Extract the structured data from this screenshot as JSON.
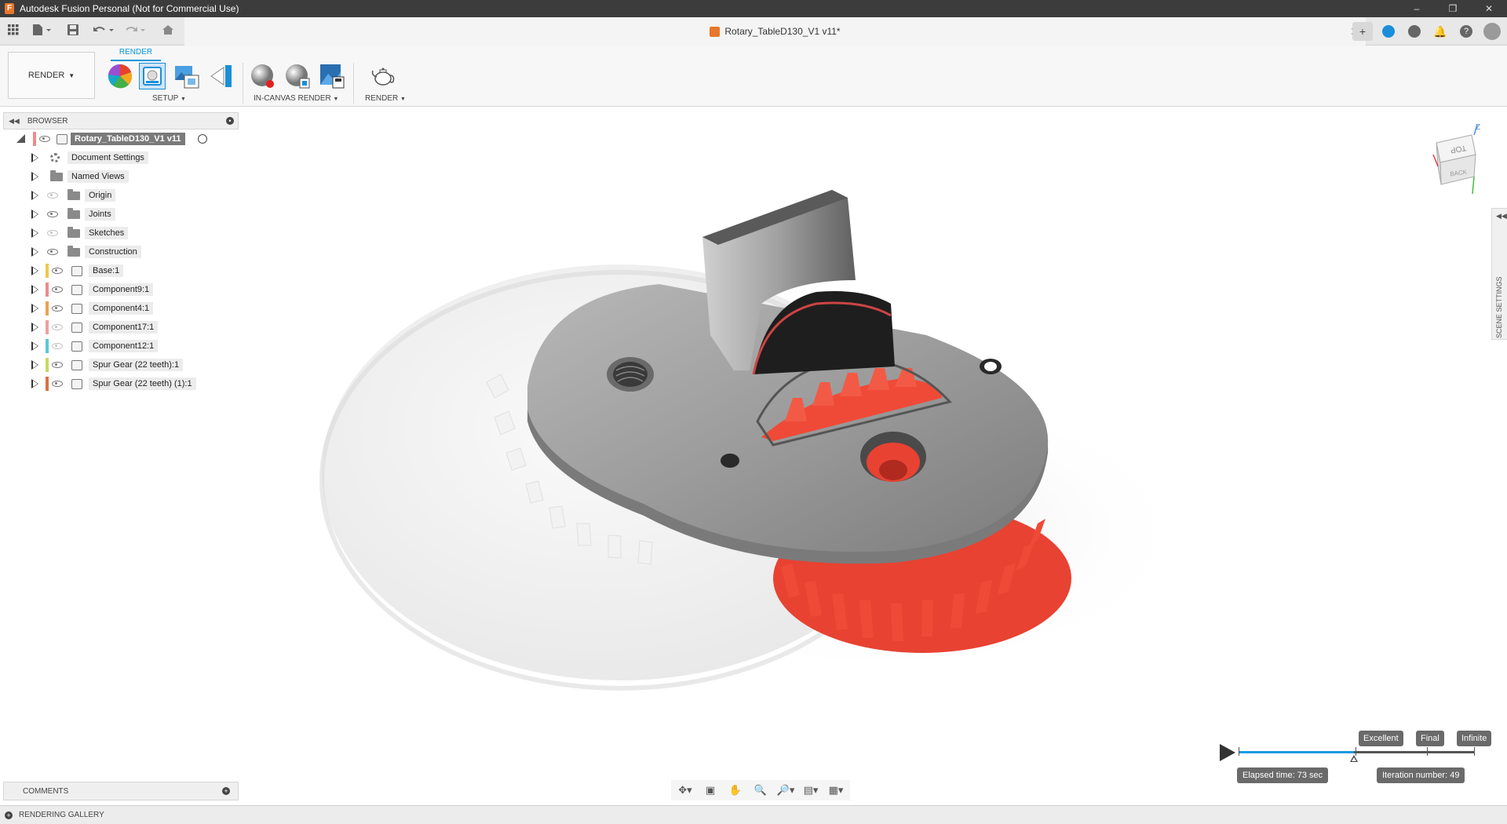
{
  "window": {
    "title": "Autodesk Fusion Personal (Not for Commercial Use)",
    "logo_letter": "F",
    "controls": [
      "–",
      "❐",
      "✕"
    ]
  },
  "document": {
    "title": "Rotary_TableD130_V1 v11*"
  },
  "ribbon": {
    "workspace": "RENDER",
    "active_tab": "RENDER",
    "groups": {
      "setup": "SETUP",
      "in_canvas": "IN-CANVAS RENDER",
      "render": "RENDER"
    }
  },
  "browser": {
    "title": "BROWSER",
    "root": "Rotary_TableD130_V1 v11",
    "items": [
      {
        "label": "Document Settings",
        "icon": "gear",
        "visible": null,
        "color": null
      },
      {
        "label": "Named Views",
        "icon": "folder",
        "visible": null,
        "color": null
      },
      {
        "label": "Origin",
        "icon": "folder",
        "visible": false,
        "color": null
      },
      {
        "label": "Joints",
        "icon": "folder",
        "visible": true,
        "color": null
      },
      {
        "label": "Sketches",
        "icon": "folder",
        "visible": false,
        "color": null
      },
      {
        "label": "Construction",
        "icon": "folder",
        "visible": true,
        "color": null
      },
      {
        "label": "Base:1",
        "icon": "component",
        "visible": true,
        "color": "#f0c84a"
      },
      {
        "label": "Component9:1",
        "icon": "component",
        "visible": true,
        "color": "#f08a8a"
      },
      {
        "label": "Component4:1",
        "icon": "component",
        "visible": true,
        "color": "#f0a050"
      },
      {
        "label": "Component17:1",
        "icon": "component",
        "visible": false,
        "color": "#f0a0a0"
      },
      {
        "label": "Component12:1",
        "icon": "component",
        "visible": false,
        "color": "#5ac8d8"
      },
      {
        "label": "Spur Gear (22 teeth):1",
        "icon": "component",
        "visible": true,
        "color": "#c8d860"
      },
      {
        "label": "Spur Gear (22 teeth) (1):1",
        "icon": "component",
        "visible": true,
        "color": "#e07040"
      }
    ]
  },
  "viewcube": {
    "top": "TOP",
    "back": "BACK",
    "axis_z": "Z"
  },
  "scene_settings": "SCENE SETTINGS",
  "comments": "COMMENTS",
  "gallery": "RENDERING GALLERY",
  "render_progress": {
    "qualities": [
      "Excellent",
      "Final",
      "Infinite"
    ],
    "elapsed": "Elapsed time: 73 sec",
    "iteration": "Iteration number: 49",
    "progress_fraction": 0.49
  }
}
